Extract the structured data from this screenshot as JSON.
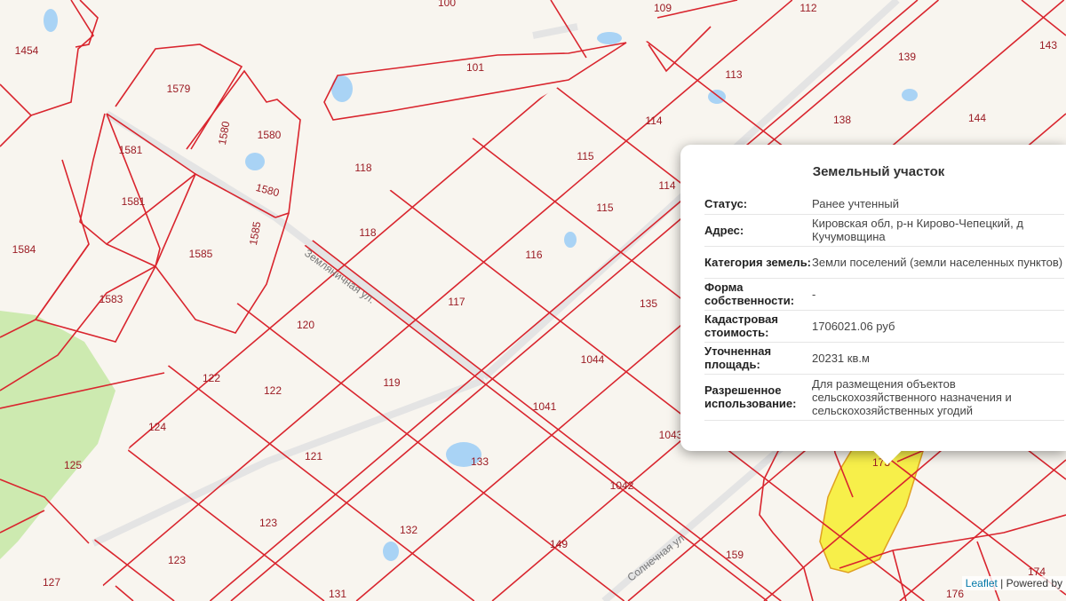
{
  "map": {
    "parcel_labels": [
      "1454",
      "100",
      "109",
      "112",
      "143",
      "101",
      "1579",
      "113",
      "139",
      "138",
      "144",
      "1580",
      "1580",
      "1581",
      "114",
      "118",
      "115",
      "1580",
      "114",
      "1581",
      "115",
      "1584",
      "118",
      "1585",
      "1585",
      "116",
      "1583",
      "117",
      "135",
      "120",
      "1044",
      "122",
      "122",
      "119",
      "1041",
      "124",
      "1043",
      "121",
      "133",
      "125",
      "173",
      "1042",
      "123",
      "132",
      "149",
      "159",
      "123",
      "127",
      "131",
      "174",
      "176"
    ],
    "street_labels": [
      "Земляничная ул.",
      "Солнечная ул."
    ],
    "colors": {
      "background": "#f8f5ef",
      "boundary": "#d9252e",
      "selected_fill": "#f7ef4a",
      "water": "#a9d3f5",
      "forest": "#cdeab0"
    }
  },
  "popup": {
    "title": "Земельный участок",
    "rows": [
      {
        "key": "Статус:",
        "value": "Ранее учтенный"
      },
      {
        "key": "Адрес:",
        "value": "Кировская обл, р-н Кирово-Чепецкий, д Кучумовщина"
      },
      {
        "key": "Категория земель:",
        "value": "Земли поселений (земли населенных пунктов)"
      },
      {
        "key": "Форма собственности:",
        "value": "-"
      },
      {
        "key": "Кадастровая стоимость:",
        "value": "1706021.06 руб"
      },
      {
        "key": "Уточненная площадь:",
        "value": "20231 кв.м"
      },
      {
        "key": "Разрешенное использование:",
        "value": "Для размещения объектов сельскохозяйственного назначения и сельскохозяйственных угодий"
      }
    ]
  },
  "attribution": {
    "link": "Leaflet",
    "separator": " | ",
    "text": "Powered by"
  }
}
